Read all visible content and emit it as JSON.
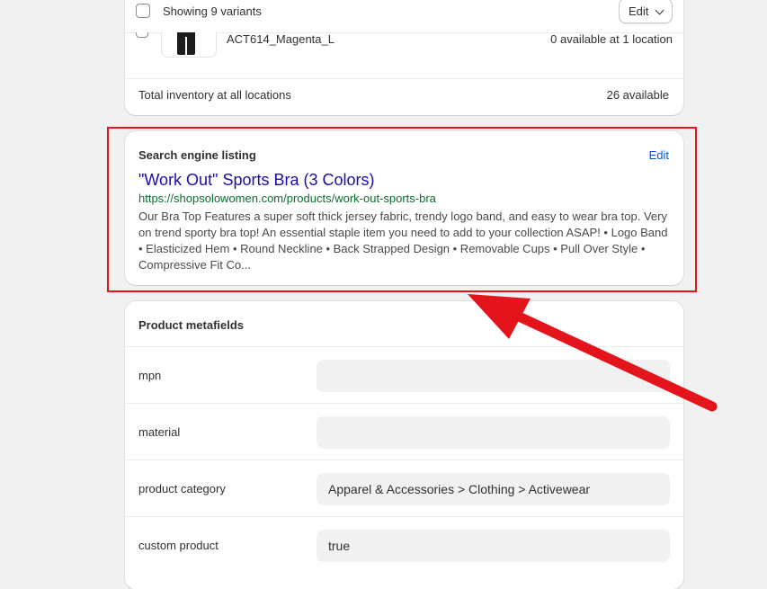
{
  "inventory": {
    "showing_label": "Showing 9 variants",
    "edit_label": "Edit",
    "variant": {
      "sku": "ACT614_Magenta_L",
      "availability": "0 available at 1 location"
    },
    "total_label": "Total inventory at all locations",
    "total_value": "26 available"
  },
  "seo": {
    "title": "Search engine listing",
    "edit_label": "Edit",
    "page_title": "\"Work Out\" Sports Bra (3 Colors)",
    "url": "https://shopsolowomen.com/products/work-out-sports-bra",
    "description": "Our Bra Top Features a super soft thick jersey fabric, trendy logo band, and easy to wear bra top. Very on trend sporty bra top! An essential staple item you need to add to your collection ASAP! • Logo Band • Elasticized Hem • Round Neckline • Back Strapped Design • Removable Cups • Pull Over Style • Compressive Fit Co..."
  },
  "metafields": {
    "title": "Product metafields",
    "rows": [
      {
        "label": "mpn",
        "value": ""
      },
      {
        "label": "material",
        "value": ""
      },
      {
        "label": "product category",
        "value": "Apparel & Accessories > Clothing > Activewear"
      },
      {
        "label": "custom product",
        "value": "true"
      }
    ]
  },
  "annotation": {
    "highlight_color": "#e3141b",
    "arrow_color": "#e3141b"
  }
}
